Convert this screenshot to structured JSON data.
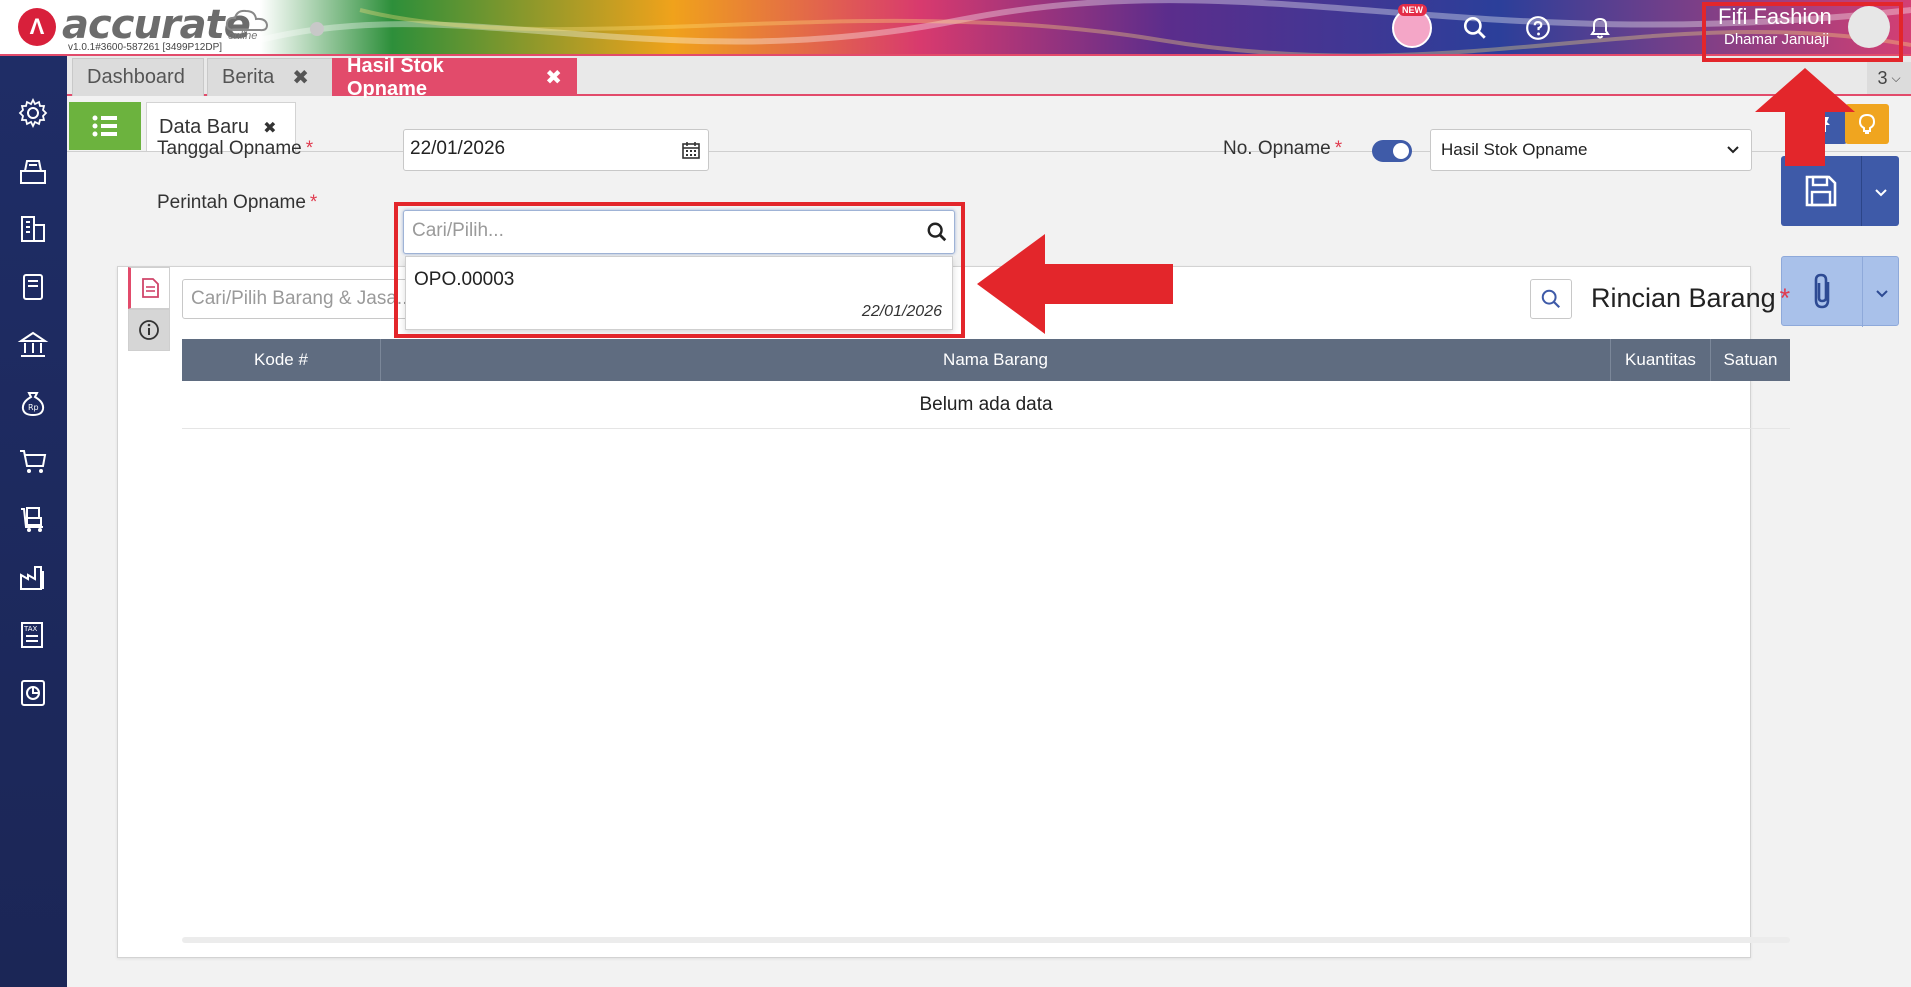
{
  "app": {
    "logo_word": "accurate",
    "logo_sub": "online",
    "version": "v1.0.1#3600-587261 [3499P12DP]",
    "badge_new": "NEW",
    "company": "Fifi Fashion",
    "user": "Dhamar Januaji"
  },
  "tabs": {
    "items": [
      {
        "label": "Dashboard"
      },
      {
        "label": "Berita"
      },
      {
        "label": "Hasil Stok Opname"
      }
    ],
    "count": "3"
  },
  "form": {
    "subtab": "Data Baru",
    "tanggal_label": "Tanggal Opname",
    "tanggal_value": "22/01/2026",
    "no_label": "No. Opname",
    "no_select": "Hasil Stok Opname",
    "perintah_label": "Perintah Opname",
    "perintah_placeholder": "Cari/Pilih...",
    "required_mark": "*"
  },
  "dropdown": {
    "items": [
      {
        "code": "OPO.00003",
        "date": "22/01/2026"
      }
    ]
  },
  "detail": {
    "search_placeholder": "Cari/Pilih Barang & Jasa...",
    "title": "Rincian Barang",
    "columns": [
      "Kode #",
      "Nama Barang",
      "Kuantitas",
      "Satuan"
    ],
    "empty": "Belum ada data"
  },
  "colors": {
    "accent": "#e24b6b",
    "sidebar": "#1f2d66",
    "primary": "#3e5aa8",
    "highlight": "#e3262b"
  }
}
